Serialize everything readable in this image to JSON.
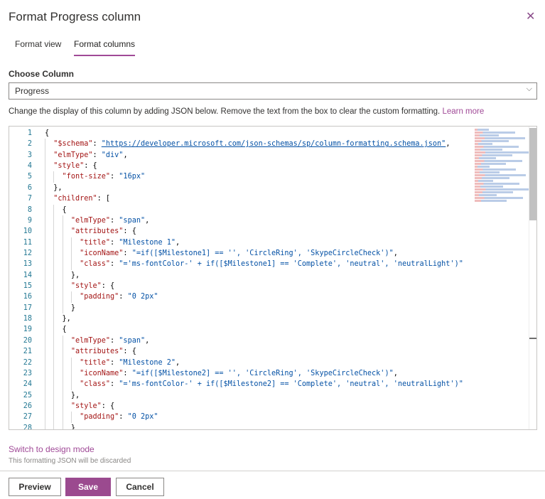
{
  "dialog": {
    "title": "Format Progress column",
    "close_icon": "close-icon"
  },
  "tabs": [
    {
      "label": "Format view",
      "active": false
    },
    {
      "label": "Format columns",
      "active": true
    }
  ],
  "choose_column": {
    "label": "Choose Column",
    "value": "Progress"
  },
  "description": {
    "text": "Change the display of this column by adding JSON below. Remove the text from the box to clear the custom formatting. ",
    "link": "Learn more"
  },
  "editor": {
    "line_numbers": [
      "1",
      "2",
      "3",
      "4",
      "5",
      "6",
      "7",
      "8",
      "9",
      "10",
      "11",
      "12",
      "13",
      "14",
      "15",
      "16",
      "17",
      "18",
      "19",
      "20",
      "21",
      "22",
      "23",
      "24",
      "25",
      "26",
      "27",
      "28"
    ],
    "lines": [
      {
        "indent": 0,
        "tokens": [
          [
            "p",
            "{"
          ]
        ]
      },
      {
        "indent": 1,
        "tokens": [
          [
            "k",
            "\"$schema\""
          ],
          [
            "p",
            ": "
          ],
          [
            "u",
            "\"https://developer.microsoft.com/json-schemas/sp/column-formatting.schema.json\""
          ],
          [
            "p",
            ","
          ]
        ]
      },
      {
        "indent": 1,
        "tokens": [
          [
            "k",
            "\"elmType\""
          ],
          [
            "p",
            ": "
          ],
          [
            "s",
            "\"div\""
          ],
          [
            "p",
            ","
          ]
        ]
      },
      {
        "indent": 1,
        "tokens": [
          [
            "k",
            "\"style\""
          ],
          [
            "p",
            ": {"
          ]
        ]
      },
      {
        "indent": 2,
        "tokens": [
          [
            "k",
            "\"font-size\""
          ],
          [
            "p",
            ": "
          ],
          [
            "s",
            "\"16px\""
          ]
        ]
      },
      {
        "indent": 1,
        "tokens": [
          [
            "p",
            "},"
          ]
        ]
      },
      {
        "indent": 1,
        "tokens": [
          [
            "k",
            "\"children\""
          ],
          [
            "p",
            ": ["
          ]
        ]
      },
      {
        "indent": 2,
        "tokens": [
          [
            "p",
            "{"
          ]
        ]
      },
      {
        "indent": 3,
        "tokens": [
          [
            "k",
            "\"elmType\""
          ],
          [
            "p",
            ": "
          ],
          [
            "s",
            "\"span\""
          ],
          [
            "p",
            ","
          ]
        ]
      },
      {
        "indent": 3,
        "tokens": [
          [
            "k",
            "\"attributes\""
          ],
          [
            "p",
            ": {"
          ]
        ]
      },
      {
        "indent": 4,
        "tokens": [
          [
            "k",
            "\"title\""
          ],
          [
            "p",
            ": "
          ],
          [
            "s",
            "\"Milestone 1\""
          ],
          [
            "p",
            ","
          ]
        ]
      },
      {
        "indent": 4,
        "tokens": [
          [
            "k",
            "\"iconName\""
          ],
          [
            "p",
            ": "
          ],
          [
            "s",
            "\"=if([$Milestone1] == '', 'CircleRing', 'SkypeCircleCheck')\""
          ],
          [
            "p",
            ","
          ]
        ]
      },
      {
        "indent": 4,
        "tokens": [
          [
            "k",
            "\"class\""
          ],
          [
            "p",
            ": "
          ],
          [
            "s",
            "\"='ms-fontColor-' + if([$Milestone1] == 'Complete', 'neutral', 'neutralLight')\""
          ]
        ]
      },
      {
        "indent": 3,
        "tokens": [
          [
            "p",
            "},"
          ]
        ]
      },
      {
        "indent": 3,
        "tokens": [
          [
            "k",
            "\"style\""
          ],
          [
            "p",
            ": {"
          ]
        ]
      },
      {
        "indent": 4,
        "tokens": [
          [
            "k",
            "\"padding\""
          ],
          [
            "p",
            ": "
          ],
          [
            "s",
            "\"0 2px\""
          ]
        ]
      },
      {
        "indent": 3,
        "tokens": [
          [
            "p",
            "}"
          ]
        ]
      },
      {
        "indent": 2,
        "tokens": [
          [
            "p",
            "},"
          ]
        ]
      },
      {
        "indent": 2,
        "tokens": [
          [
            "p",
            "{"
          ]
        ]
      },
      {
        "indent": 3,
        "tokens": [
          [
            "k",
            "\"elmType\""
          ],
          [
            "p",
            ": "
          ],
          [
            "s",
            "\"span\""
          ],
          [
            "p",
            ","
          ]
        ]
      },
      {
        "indent": 3,
        "tokens": [
          [
            "k",
            "\"attributes\""
          ],
          [
            "p",
            ": {"
          ]
        ]
      },
      {
        "indent": 4,
        "tokens": [
          [
            "k",
            "\"title\""
          ],
          [
            "p",
            ": "
          ],
          [
            "s",
            "\"Milestone 2\""
          ],
          [
            "p",
            ","
          ]
        ]
      },
      {
        "indent": 4,
        "tokens": [
          [
            "k",
            "\"iconName\""
          ],
          [
            "p",
            ": "
          ],
          [
            "s",
            "\"=if([$Milestone2] == '', 'CircleRing', 'SkypeCircleCheck')\""
          ],
          [
            "p",
            ","
          ]
        ]
      },
      {
        "indent": 4,
        "tokens": [
          [
            "k",
            "\"class\""
          ],
          [
            "p",
            ": "
          ],
          [
            "s",
            "\"='ms-fontColor-' + if([$Milestone2] == 'Complete', 'neutral', 'neutralLight')\""
          ]
        ]
      },
      {
        "indent": 3,
        "tokens": [
          [
            "p",
            "},"
          ]
        ]
      },
      {
        "indent": 3,
        "tokens": [
          [
            "k",
            "\"style\""
          ],
          [
            "p",
            ": {"
          ]
        ]
      },
      {
        "indent": 4,
        "tokens": [
          [
            "k",
            "\"padding\""
          ],
          [
            "p",
            ": "
          ],
          [
            "s",
            "\"0 2px\""
          ]
        ]
      },
      {
        "indent": 3,
        "tokens": [
          [
            "p",
            "}"
          ]
        ]
      }
    ]
  },
  "footer": {
    "switch_link": "Switch to design mode",
    "note": "This formatting JSON will be discarded",
    "preview": "Preview",
    "save": "Save",
    "cancel": "Cancel"
  },
  "colors": {
    "accent": "#9b4a8f",
    "key": "#a31515",
    "string": "#0451a5",
    "line_number": "#237893"
  }
}
